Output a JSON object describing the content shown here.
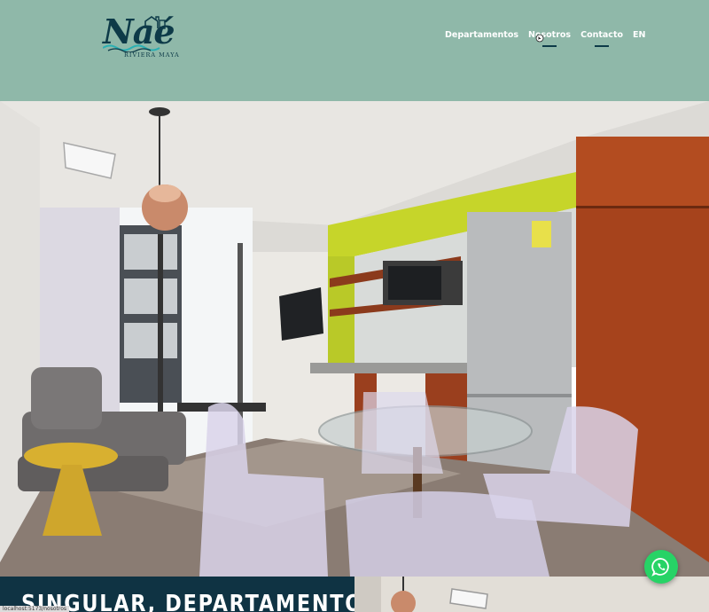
{
  "brand": {
    "name": "Naé",
    "tagline": "RIVIERA MAYA"
  },
  "nav": {
    "items": [
      {
        "label": "Departamentos"
      },
      {
        "label": "Nosotros"
      },
      {
        "label": "Contacto"
      },
      {
        "label": "EN"
      }
    ]
  },
  "hero": {
    "image_description_icon": "apartment-interior-photo"
  },
  "banner": {
    "title": "SINGULAR, DEPARTAMENTO CON"
  },
  "status_bar": {
    "url": "localhost:5173/nosotros"
  },
  "colors": {
    "header_bg": "#8fb8a9",
    "brand_dark": "#0d3a48",
    "banner_bg": "#0f3343",
    "whatsapp": "#27d366"
  },
  "icons": [
    "house-icon",
    "waves-icon",
    "cursor-icon",
    "whatsapp-icon"
  ]
}
